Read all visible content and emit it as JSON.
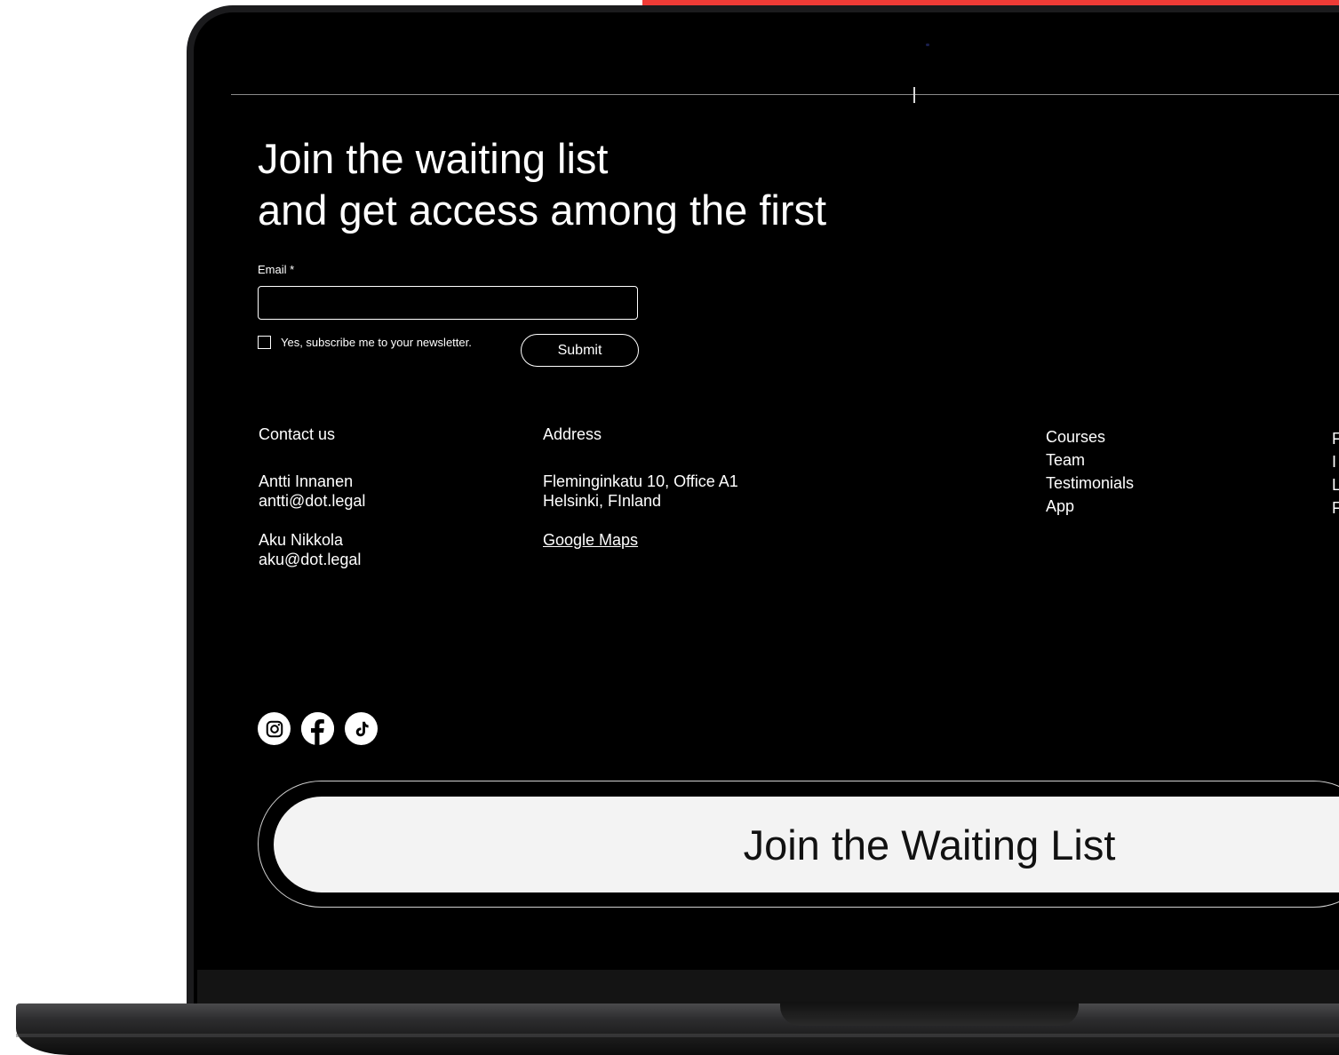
{
  "form": {
    "headline_line1": "Join the waiting list",
    "headline_line2": "and get access among the first",
    "email_label": "Email *",
    "email_value": "",
    "subscribe_label": "Yes, subscribe me to your newsletter.",
    "subscribe_checked": false,
    "submit_label": "Submit"
  },
  "contact": {
    "heading": "Contact us",
    "people": [
      {
        "name": "Antti Innanen",
        "email": "antti@dot.legal"
      },
      {
        "name": "Aku Nikkola",
        "email": "aku@dot.legal"
      }
    ]
  },
  "address": {
    "heading": "Address",
    "line1": "Fleminginkatu 10, Office A1",
    "line2": "Helsinki, FInland",
    "map_link": "Google Maps"
  },
  "nav": {
    "items": [
      "Courses",
      "Team",
      "Testimonials",
      "App"
    ],
    "clipped_items": [
      "F",
      "I",
      "L",
      "F"
    ]
  },
  "social": {
    "icons": [
      "instagram-icon",
      "facebook-icon",
      "tiktok-icon"
    ]
  },
  "cta": {
    "label": "Join the Waiting List"
  },
  "colors": {
    "screen_bg": "#000000",
    "accent_red": "#ef3b36",
    "cta_bg": "#f3f3f3",
    "text": "#ffffff"
  }
}
